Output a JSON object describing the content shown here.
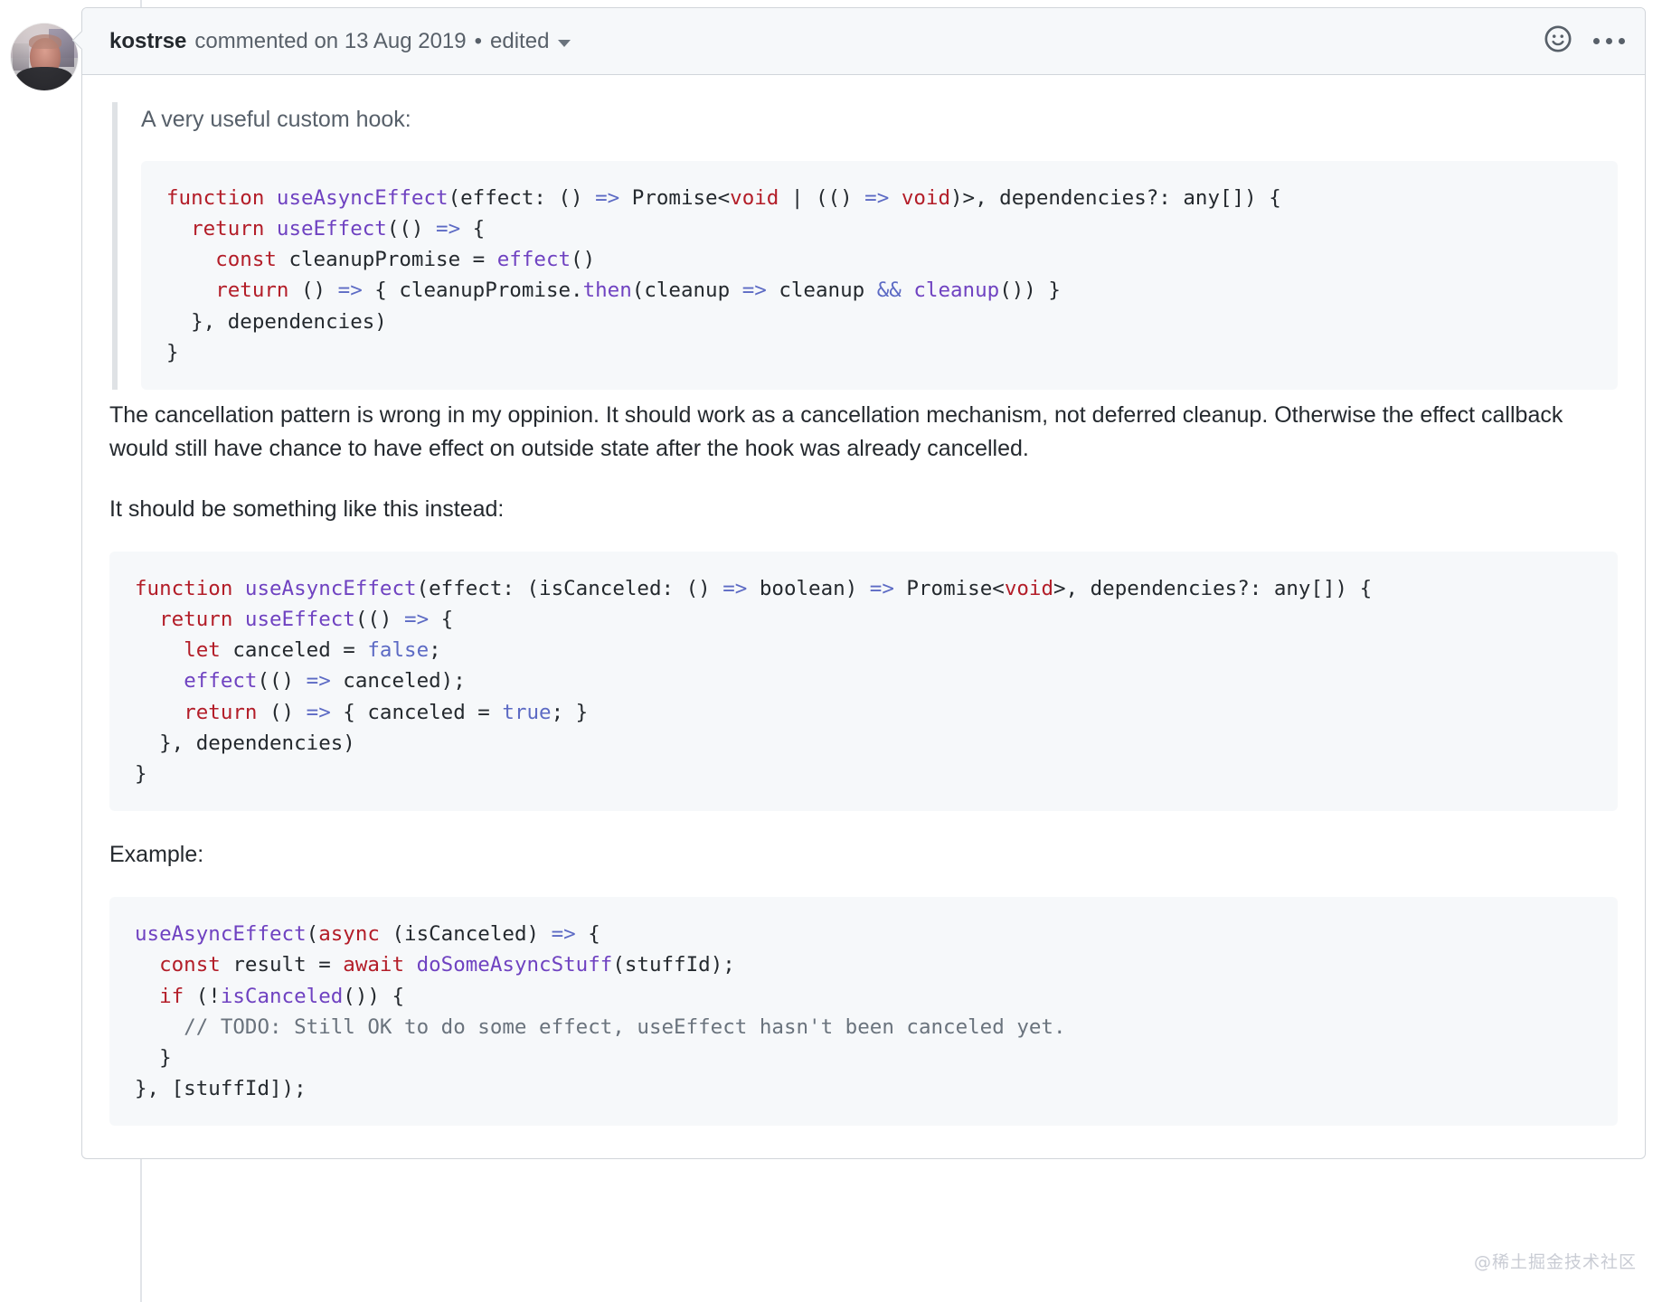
{
  "thread": {
    "avatar_alt": "kostrse avatar"
  },
  "comment": {
    "header": {
      "author": "kostrse",
      "action": "commented on 13 Aug 2019",
      "separator": "•",
      "edited_label": "edited",
      "caret_icon": "chevron-down-icon",
      "reaction_icon": "smiley-icon",
      "menu_icon": "kebab-horizontal-icon"
    },
    "body": {
      "quote_text": "A very useful custom hook:",
      "code1": {
        "lines": [
          [
            {
              "t": "function ",
              "c": "k"
            },
            {
              "t": "useAsyncEffect",
              "c": "fn"
            },
            {
              "t": "(effect: () ",
              "c": "pl"
            },
            {
              "t": "=>",
              "c": "op"
            },
            {
              "t": " Promise<",
              "c": "pl"
            },
            {
              "t": "void",
              "c": "k"
            },
            {
              "t": " | (() ",
              "c": "pl"
            },
            {
              "t": "=>",
              "c": "op"
            },
            {
              "t": " ",
              "c": "pl"
            },
            {
              "t": "void",
              "c": "k"
            },
            {
              "t": ")>, dependencies?: any[]) {",
              "c": "pl"
            }
          ],
          [
            {
              "t": "  ",
              "c": "pl"
            },
            {
              "t": "return ",
              "c": "k"
            },
            {
              "t": "useEffect",
              "c": "fn"
            },
            {
              "t": "(() ",
              "c": "pl"
            },
            {
              "t": "=>",
              "c": "op"
            },
            {
              "t": " {",
              "c": "pl"
            }
          ],
          [
            {
              "t": "    ",
              "c": "pl"
            },
            {
              "t": "const ",
              "c": "k"
            },
            {
              "t": "cleanupPromise = ",
              "c": "pl"
            },
            {
              "t": "effect",
              "c": "fn"
            },
            {
              "t": "()",
              "c": "pl"
            }
          ],
          [
            {
              "t": "    ",
              "c": "pl"
            },
            {
              "t": "return ",
              "c": "k"
            },
            {
              "t": "() ",
              "c": "pl"
            },
            {
              "t": "=>",
              "c": "op"
            },
            {
              "t": " { cleanupPromise.",
              "c": "pl"
            },
            {
              "t": "then",
              "c": "fn"
            },
            {
              "t": "(cleanup ",
              "c": "pl"
            },
            {
              "t": "=>",
              "c": "op"
            },
            {
              "t": " cleanup ",
              "c": "pl"
            },
            {
              "t": "&&",
              "c": "op"
            },
            {
              "t": " ",
              "c": "pl"
            },
            {
              "t": "cleanup",
              "c": "fn"
            },
            {
              "t": "()) }",
              "c": "pl"
            }
          ],
          [
            {
              "t": "  }, dependencies)",
              "c": "pl"
            }
          ],
          [
            {
              "t": "}",
              "c": "pl"
            }
          ]
        ]
      },
      "para1": "The cancellation pattern is wrong in my oppinion. It should work as a cancellation mechanism, not deferred cleanup. Otherwise the effect callback would still have chance to have effect on outside state after the hook was already cancelled.",
      "para2": "It should be something like this instead:",
      "code2": {
        "lines": [
          [
            {
              "t": "function ",
              "c": "k"
            },
            {
              "t": "useAsyncEffect",
              "c": "fn"
            },
            {
              "t": "(effect: (isCanceled: () ",
              "c": "pl"
            },
            {
              "t": "=>",
              "c": "op"
            },
            {
              "t": " boolean) ",
              "c": "pl"
            },
            {
              "t": "=>",
              "c": "op"
            },
            {
              "t": " Promise<",
              "c": "pl"
            },
            {
              "t": "void",
              "c": "k"
            },
            {
              "t": ">, dependencies?: any[]) {",
              "c": "pl"
            }
          ],
          [
            {
              "t": "  ",
              "c": "pl"
            },
            {
              "t": "return ",
              "c": "k"
            },
            {
              "t": "useEffect",
              "c": "fn"
            },
            {
              "t": "(() ",
              "c": "pl"
            },
            {
              "t": "=>",
              "c": "op"
            },
            {
              "t": " {",
              "c": "pl"
            }
          ],
          [
            {
              "t": "    ",
              "c": "pl"
            },
            {
              "t": "let ",
              "c": "k"
            },
            {
              "t": "canceled = ",
              "c": "pl"
            },
            {
              "t": "false",
              "c": "lit"
            },
            {
              "t": ";",
              "c": "pl"
            }
          ],
          [
            {
              "t": "    ",
              "c": "pl"
            },
            {
              "t": "effect",
              "c": "fn"
            },
            {
              "t": "(() ",
              "c": "pl"
            },
            {
              "t": "=>",
              "c": "op"
            },
            {
              "t": " canceled);",
              "c": "pl"
            }
          ],
          [
            {
              "t": "    ",
              "c": "pl"
            },
            {
              "t": "return ",
              "c": "k"
            },
            {
              "t": "() ",
              "c": "pl"
            },
            {
              "t": "=>",
              "c": "op"
            },
            {
              "t": " { canceled = ",
              "c": "pl"
            },
            {
              "t": "true",
              "c": "lit"
            },
            {
              "t": "; }",
              "c": "pl"
            }
          ],
          [
            {
              "t": "  }, dependencies)",
              "c": "pl"
            }
          ],
          [
            {
              "t": "}",
              "c": "pl"
            }
          ]
        ]
      },
      "para3": "Example:",
      "code3": {
        "lines": [
          [
            {
              "t": "useAsyncEffect",
              "c": "fn"
            },
            {
              "t": "(",
              "c": "pl"
            },
            {
              "t": "async ",
              "c": "k"
            },
            {
              "t": "(isCanceled) ",
              "c": "pl"
            },
            {
              "t": "=>",
              "c": "op"
            },
            {
              "t": " {",
              "c": "pl"
            }
          ],
          [
            {
              "t": "  ",
              "c": "pl"
            },
            {
              "t": "const ",
              "c": "k"
            },
            {
              "t": "result = ",
              "c": "pl"
            },
            {
              "t": "await ",
              "c": "k"
            },
            {
              "t": "doSomeAsyncStuff",
              "c": "fn"
            },
            {
              "t": "(stuffId);",
              "c": "pl"
            }
          ],
          [
            {
              "t": "  ",
              "c": "pl"
            },
            {
              "t": "if ",
              "c": "k"
            },
            {
              "t": "(!",
              "c": "pl"
            },
            {
              "t": "isCanceled",
              "c": "fn"
            },
            {
              "t": "()) {",
              "c": "pl"
            }
          ],
          [
            {
              "t": "    ",
              "c": "pl"
            },
            {
              "t": "// TODO: Still OK to do some effect, useEffect hasn't been canceled yet.",
              "c": "cm"
            }
          ],
          [
            {
              "t": "  }",
              "c": "pl"
            }
          ],
          [
            {
              "t": "}, [stuffId]);",
              "c": "pl"
            }
          ]
        ]
      }
    }
  },
  "watermark": "@稀土掘金技术社区"
}
